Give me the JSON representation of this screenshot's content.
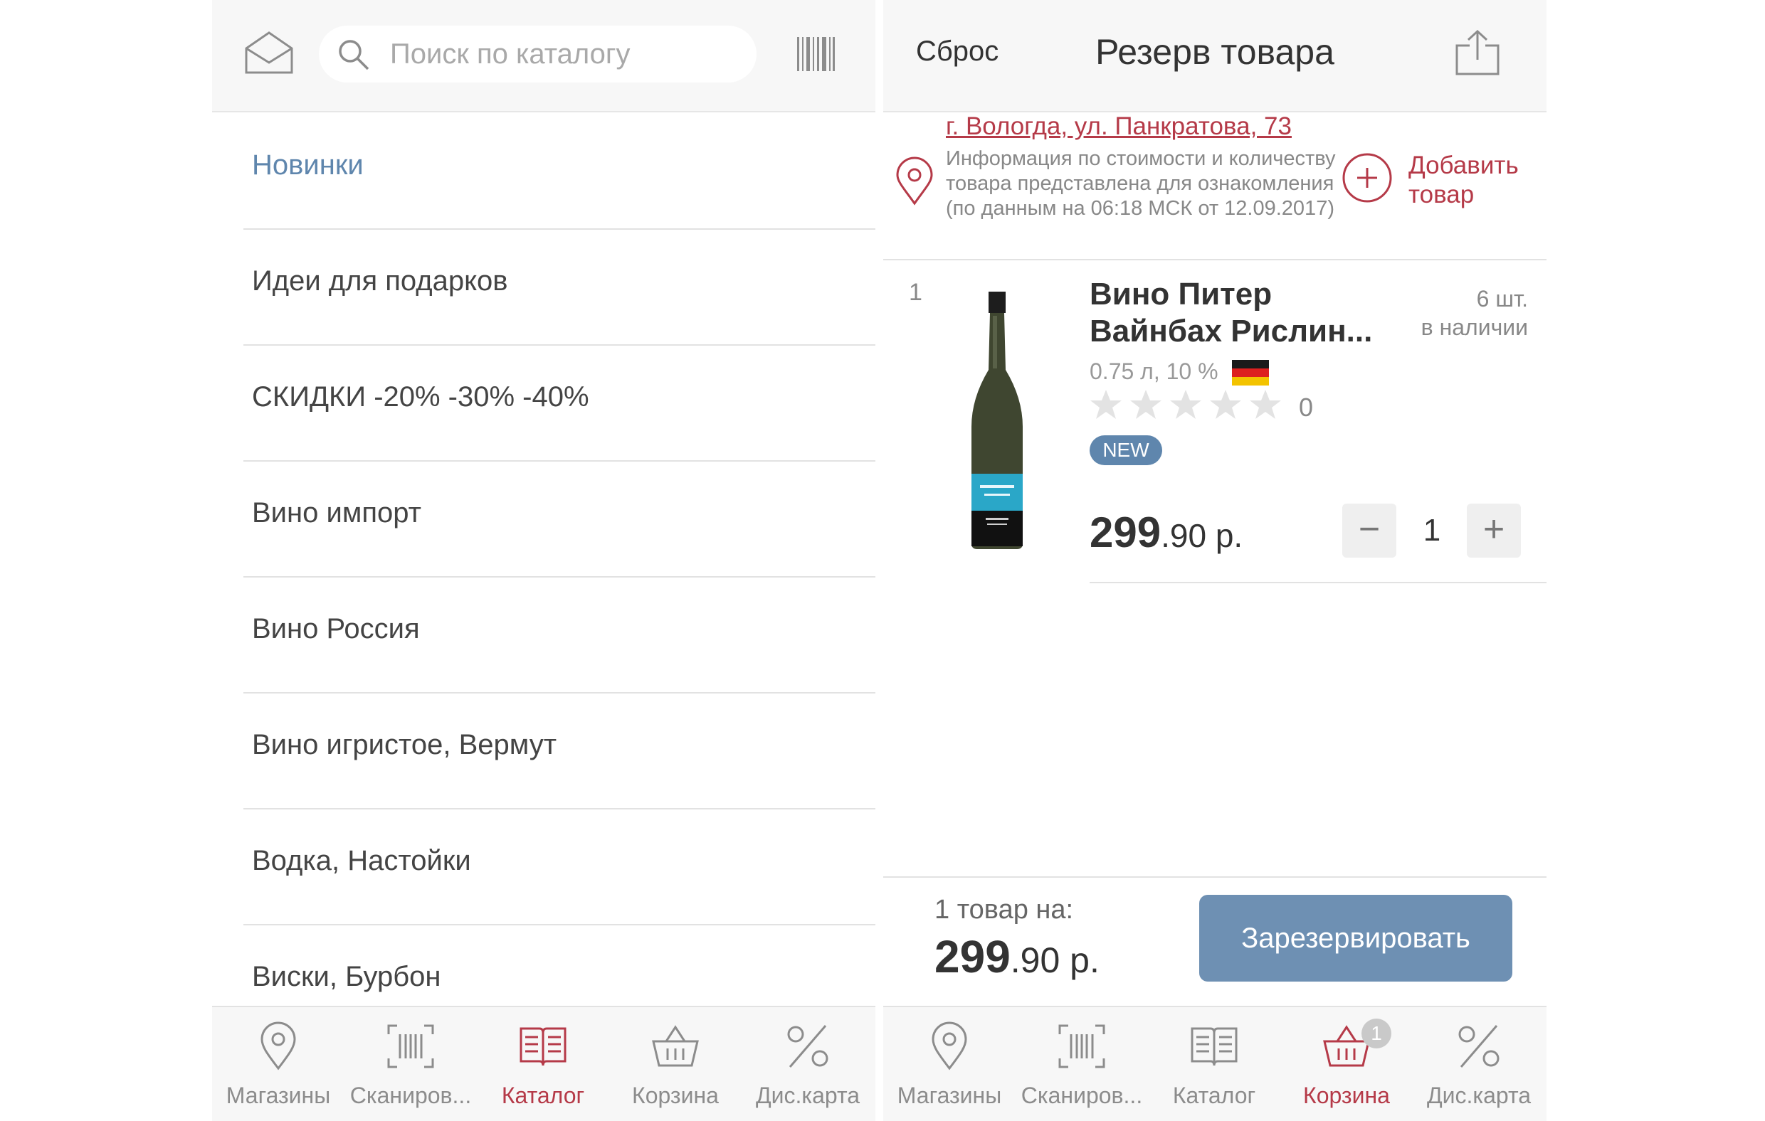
{
  "catalog_screen": {
    "search": {
      "placeholder": "Поиск по каталогу",
      "icon": "search-icon"
    },
    "categories": [
      {
        "label": "Новинки",
        "active": true
      },
      {
        "label": "Идеи для подарков"
      },
      {
        "label": "СКИДКИ -20% -30% -40%"
      },
      {
        "label": "Вино импорт"
      },
      {
        "label": "Вино Россия"
      },
      {
        "label": "Вино игристое, Вермут"
      },
      {
        "label": "Водка, Настойки"
      },
      {
        "label": "Виски, Бурбон"
      }
    ],
    "tabs": [
      {
        "label": "Магазины",
        "icon": "map-pin-icon"
      },
      {
        "label": "Сканиров...",
        "icon": "barcode-scan-icon"
      },
      {
        "label": "Каталог",
        "icon": "catalog-book-icon",
        "active": true
      },
      {
        "label": "Корзина",
        "icon": "basket-icon"
      },
      {
        "label": "Дис.карта",
        "icon": "percent-icon"
      }
    ]
  },
  "reserve_screen": {
    "header": {
      "reset_label": "Сброс",
      "title": "Резерв товара",
      "share_icon": "share-icon"
    },
    "store": {
      "address": "г. Вологда, ул. Панкратова, 73",
      "info": "Информация по стоимости и количеству товара представлена для ознакомления (по данным на 06:18 МСК от 12.09.2017)",
      "add_label": "Добавить товар"
    },
    "product": {
      "index": "1",
      "name": "Вино Питер Вайнбах Рислин...",
      "volume_abv": "0.75 л, 10 %",
      "country_flag": "germany-flag",
      "stock_qty": "6 шт.",
      "stock_label": "в наличии",
      "rating": "0",
      "rating_value": 0,
      "rating_max": 5,
      "badge": "NEW",
      "price_int": "299",
      "price_rest": ".90 р.",
      "quantity": "1",
      "minus_label": "−",
      "plus_label": "+"
    },
    "summary": {
      "label": "1 товар на:",
      "price_int": "299",
      "price_rest": ".90 р.",
      "reserve_button": "Зарезервировать"
    },
    "tabs": [
      {
        "label": "Магазины",
        "icon": "map-pin-icon"
      },
      {
        "label": "Сканиров...",
        "icon": "barcode-scan-icon"
      },
      {
        "label": "Каталог",
        "icon": "catalog-book-icon"
      },
      {
        "label": "Корзина",
        "icon": "basket-icon",
        "active": true,
        "badge": "1"
      },
      {
        "label": "Дис.карта",
        "icon": "percent-icon"
      }
    ]
  },
  "colors": {
    "accent_red": "#b53a48",
    "accent_blue": "#5f86ad",
    "button_blue": "#6e90b3",
    "muted": "#888888"
  }
}
